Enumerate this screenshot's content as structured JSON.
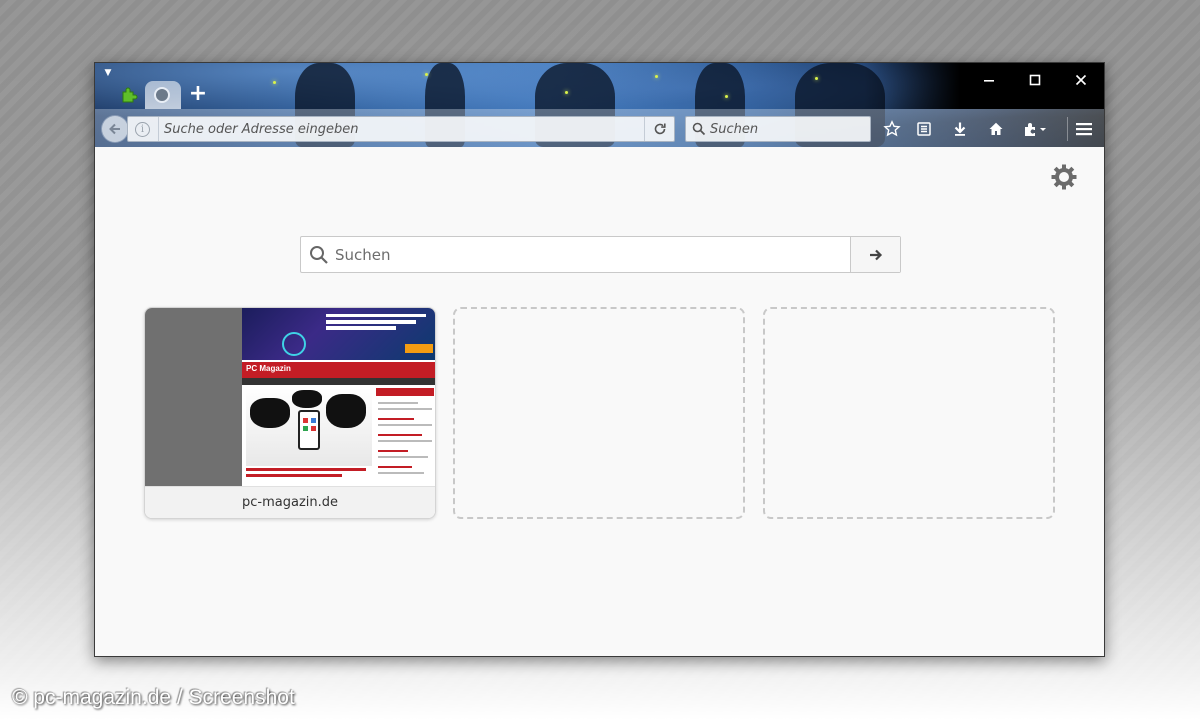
{
  "window": {
    "tab_new_symbol": "+",
    "controls": {
      "minimize": "—",
      "maximize": "□",
      "close": "✕"
    }
  },
  "navbar": {
    "url_placeholder": "Suche oder Adresse eingeben",
    "search_placeholder": "Suchen"
  },
  "content": {
    "search_placeholder": "Suchen",
    "tiles": [
      {
        "caption": "pc-magazin.de",
        "thumb_logo": "PC Magazin"
      },
      {
        "caption": ""
      },
      {
        "caption": ""
      }
    ]
  },
  "watermark": "© pc-magazin.de / Screenshot",
  "colors": {
    "brand_red": "#c31d25",
    "page_bg": "#f9f9f9"
  }
}
